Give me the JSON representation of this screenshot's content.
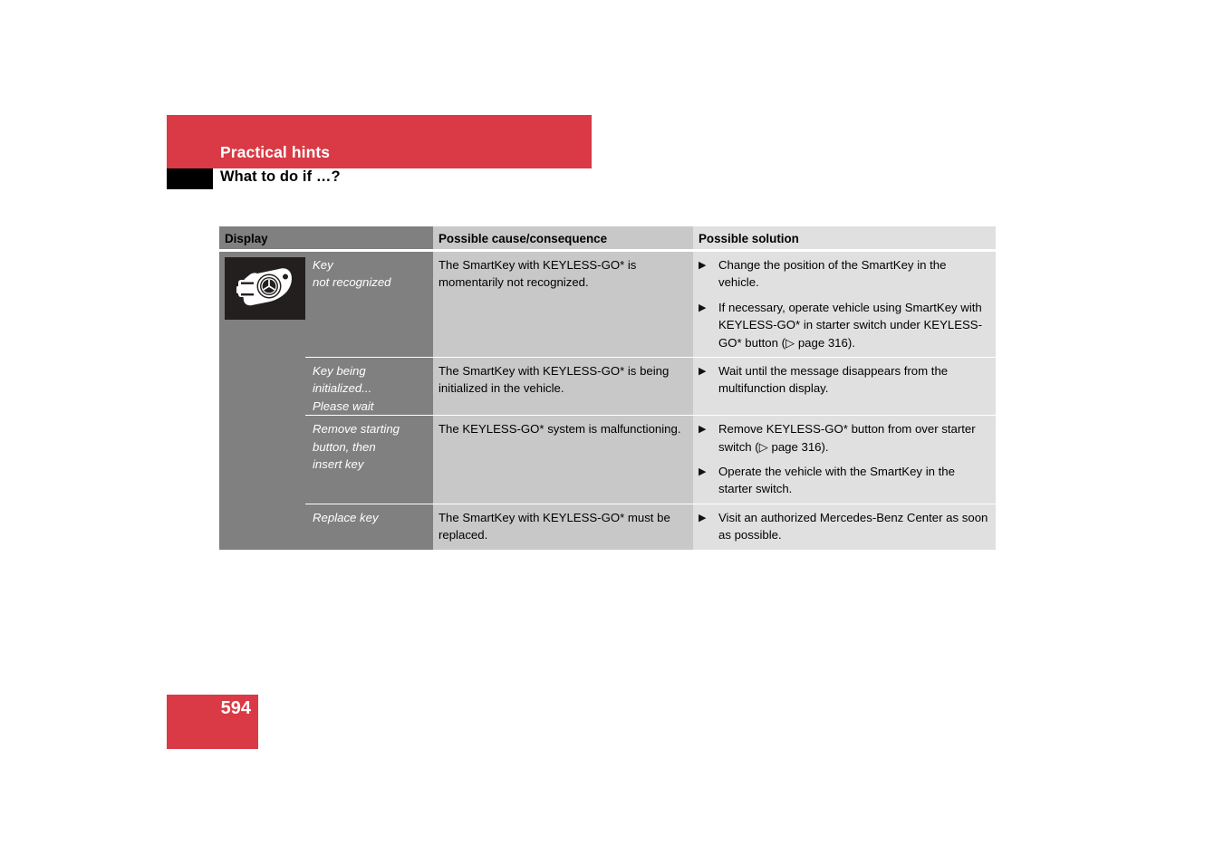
{
  "header": {
    "section_title": "Practical hints",
    "subsection_title": "What to do if …?"
  },
  "table": {
    "columns": [
      "Display",
      "Possible cause/consequence",
      "Possible solution"
    ],
    "rows": [
      {
        "icon": "smartkey-icon",
        "display_message": "Key\nnot recognized",
        "cause": "The SmartKey with KEYLESS-GO* is momentarily not recognized.",
        "solutions": [
          "Change the position of the SmartKey in the vehicle.",
          "If necessary, operate vehicle using SmartKey with KEYLESS-GO* in starter switch under KEYLESS-GO* button (▷ page 316)."
        ]
      },
      {
        "icon": "",
        "display_message": "Key being\ninitialized...\nPlease wait",
        "cause": "The SmartKey with KEYLESS-GO* is being initialized in the vehicle.",
        "solutions": [
          "Wait until the message disappears from the multifunction display."
        ]
      },
      {
        "icon": "",
        "display_message": "Remove starting\nbutton, then\ninsert key",
        "cause": "The KEYLESS-GO* system is malfunctioning.",
        "solutions": [
          "Remove KEYLESS-GO* button from over starter switch (▷ page 316).",
          "Operate the vehicle with the SmartKey in the starter switch."
        ]
      },
      {
        "icon": "",
        "display_message": "Replace key",
        "cause": "The SmartKey with KEYLESS-GO* must be replaced.",
        "solutions": [
          "Visit an authorized Mercedes-Benz Center as soon as possible."
        ]
      }
    ]
  },
  "footer": {
    "page_number": "594"
  },
  "colors": {
    "accent_red": "#d93a45",
    "display_col_bg": "#808080",
    "cause_col_bg": "#c8c8c8",
    "solution_col_bg": "#e0e0e0",
    "icon_bg": "#231f1e"
  },
  "bullet_glyph": "▶"
}
